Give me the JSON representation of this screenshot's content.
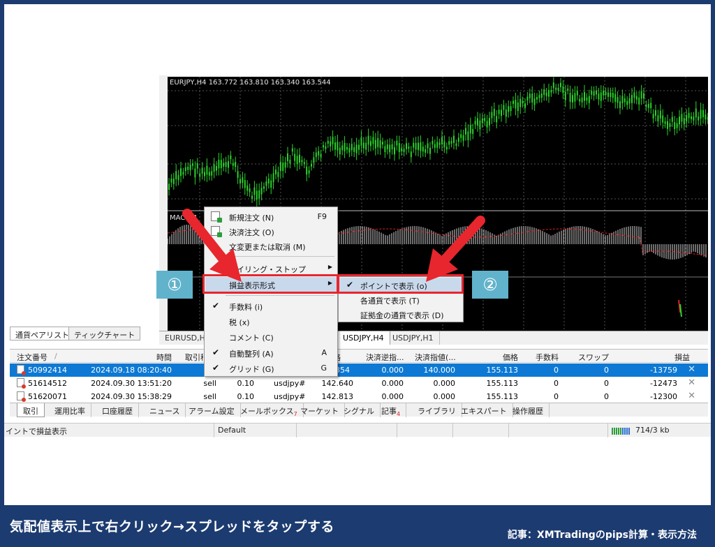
{
  "chart": {
    "title": "EURJPY,H4  163.772 163.810 163.340 163.544",
    "macd_label": "MACD(1",
    "candle_color": "#2cd32c",
    "background": "#000000"
  },
  "chart_tabs": [
    "EURUSD,H4",
    "USDJPY,H4",
    "USDJPY,H1"
  ],
  "nav_tabs": [
    "通貨ペアリスト",
    "ティックチャート"
  ],
  "table": {
    "headers": [
      "注文番号",
      "/",
      "時間",
      "取引種別",
      "数量",
      "通貨ペア",
      "価格",
      "決済逆指...",
      "決済指値(...",
      "価格",
      "手数料",
      "スワップ",
      "損益"
    ],
    "rows": [
      {
        "order": "50992414",
        "time": "2024.09.18 08:20:40",
        "type": "",
        "volume": "",
        "symbol": "",
        "price": "354",
        "sl": "0.000",
        "tp": "140.000",
        "cur_price": "155.113",
        "commission": "0",
        "swap": "0",
        "profit": "-13759"
      },
      {
        "order": "51614512",
        "time": "2024.09.30 13:51:20",
        "type": "sell",
        "volume": "0.10",
        "symbol": "usdjpy#",
        "price": "142.640",
        "sl": "0.000",
        "tp": "0.000",
        "cur_price": "155.113",
        "commission": "0",
        "swap": "0",
        "profit": "-12473"
      },
      {
        "order": "51620071",
        "time": "2024.09.30 15:38:29",
        "type": "sell",
        "volume": "0.10",
        "symbol": "usdjpy#",
        "price": "142.813",
        "sl": "0.000",
        "tp": "0.000",
        "cur_price": "155.113",
        "commission": "0",
        "swap": "0",
        "profit": "-12300"
      }
    ]
  },
  "bottom_tabs": [
    "取引",
    "運用比率",
    "口座履歴",
    "ニュース",
    "アラーム設定",
    "メールボックス",
    "マーケット",
    "シグナル",
    "記事",
    "ライブラリ",
    "エキスパート",
    "操作履歴"
  ],
  "bottom_tab_badges": {
    "mailbox": "7",
    "articles": "4"
  },
  "status": {
    "hint": "イントで損益表示",
    "profile": "Default",
    "traffic": "714/3 kb"
  },
  "context_menu": {
    "new_order": "新規注文 (N)",
    "new_order_key": "F9",
    "close_order": "決済注文 (O)",
    "modify_order": "文変更または取消 (M)",
    "trailing_stop": "レイリング・ストップ",
    "profit_display": "損益表示形式",
    "commission": "手数料 (i)",
    "tax": "税 (x)",
    "comment": "コメント (C)",
    "auto_arrange": "自動整列 (A)",
    "auto_arrange_key": "A",
    "grid": "グリッド (G)",
    "grid_key": "G"
  },
  "sub_menu": {
    "points": "ポイントで表示 (o)",
    "currency": "各通貨で表示 (T)",
    "deposit": "証拠金の通貨で表示 (D)"
  },
  "badges": {
    "one": "①",
    "two": "②"
  },
  "colors": {
    "highlight": "#e8262d",
    "badge": "#61b3cb",
    "selected_row": "#0d79d4",
    "frame": "#1c3b70"
  },
  "footer": {
    "caption": "気配値表示上で右クリック→スプレッドをタップする",
    "article": "記事：XMTradingのpips計算・表示方法"
  }
}
